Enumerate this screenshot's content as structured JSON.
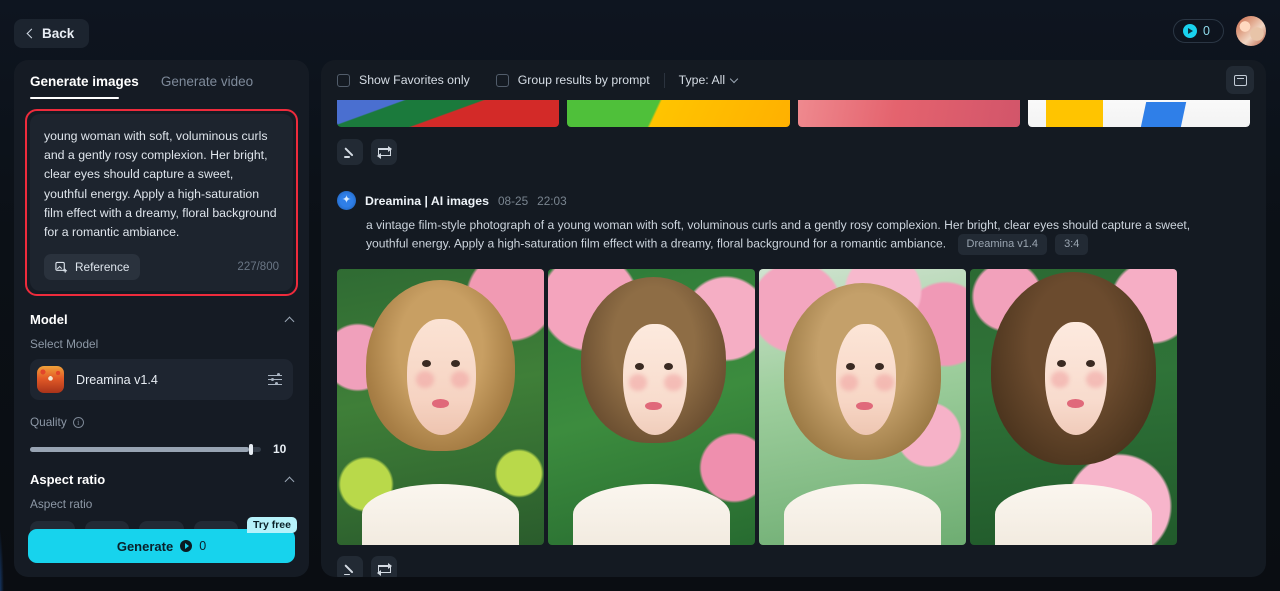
{
  "topbar": {
    "back_label": "Back",
    "credits_count": "0",
    "credits_icon": "coin-icon",
    "avatar_icon": "user-avatar"
  },
  "left_panel": {
    "tabs": [
      {
        "label": "Generate images",
        "active": true
      },
      {
        "label": "Generate video",
        "active": false
      }
    ],
    "prompt": {
      "value": "young woman with soft, voluminous curls and a gently rosy complexion. Her bright, clear eyes should capture a sweet, youthful energy. Apply a high-saturation film effect with a dreamy, floral background for a romantic ambiance.",
      "reference_label": "Reference",
      "reference_icon": "image-plus-icon",
      "char_count": "227/800",
      "highlight_color": "#ee2b3c"
    },
    "model_section": {
      "title": "Model",
      "sub_label": "Select Model",
      "selected_model": "Dreamina v1.4",
      "settings_icon": "sliders-icon",
      "collapse_icon": "chevron-up-icon"
    },
    "quality": {
      "label": "Quality",
      "info_icon": "info-icon",
      "value": "10",
      "percent": 95
    },
    "aspect_section": {
      "title": "Aspect ratio",
      "sub_label": "Aspect ratio",
      "collapse_icon": "chevron-up-icon",
      "options": [
        {
          "name": "ratio-21-9",
          "w": 22,
          "h": 10
        },
        {
          "name": "ratio-16-9",
          "w": 19,
          "h": 12
        },
        {
          "name": "ratio-4-3",
          "w": 17,
          "h": 13
        },
        {
          "name": "ratio-3-4",
          "w": 15,
          "h": 14
        },
        {
          "name": "ratio-1-1",
          "w": 14,
          "h": 15
        }
      ]
    },
    "generate": {
      "label": "Generate",
      "cost": "0",
      "coin_icon": "coin-icon",
      "badge": "Try free",
      "accent_color": "#17d3ed"
    }
  },
  "right_panel": {
    "filters": {
      "favorites_label": "Show Favorites only",
      "favorites_checked": false,
      "group_label": "Group results by prompt",
      "group_checked": false,
      "type_label": "Type: All",
      "type_chevron": "chevron-down-icon",
      "archive_icon": "folder-icon"
    },
    "previous_result": {
      "edit_icon": "pencil-icon",
      "regenerate_icon": "loop-arrows-icon"
    },
    "result": {
      "brand_icon": "dreamina-logo-icon",
      "brand_name": "Dreamina | AI images",
      "date": "08-25",
      "time": "22:03",
      "prompt": "a vintage film-style photograph of a young woman with soft, voluminous curls and a gently rosy complexion. Her bright, clear eyes should capture a sweet, youthful energy. Apply a high-saturation film effect with a dreamy, floral background for a romantic ambiance.",
      "tags": [
        "Dreamina v1.4",
        "3:4"
      ],
      "images": [
        {
          "alt": "portrait-1"
        },
        {
          "alt": "portrait-2"
        },
        {
          "alt": "portrait-3"
        },
        {
          "alt": "portrait-4"
        }
      ],
      "edit_icon": "pencil-icon",
      "regenerate_icon": "loop-arrows-icon"
    }
  }
}
